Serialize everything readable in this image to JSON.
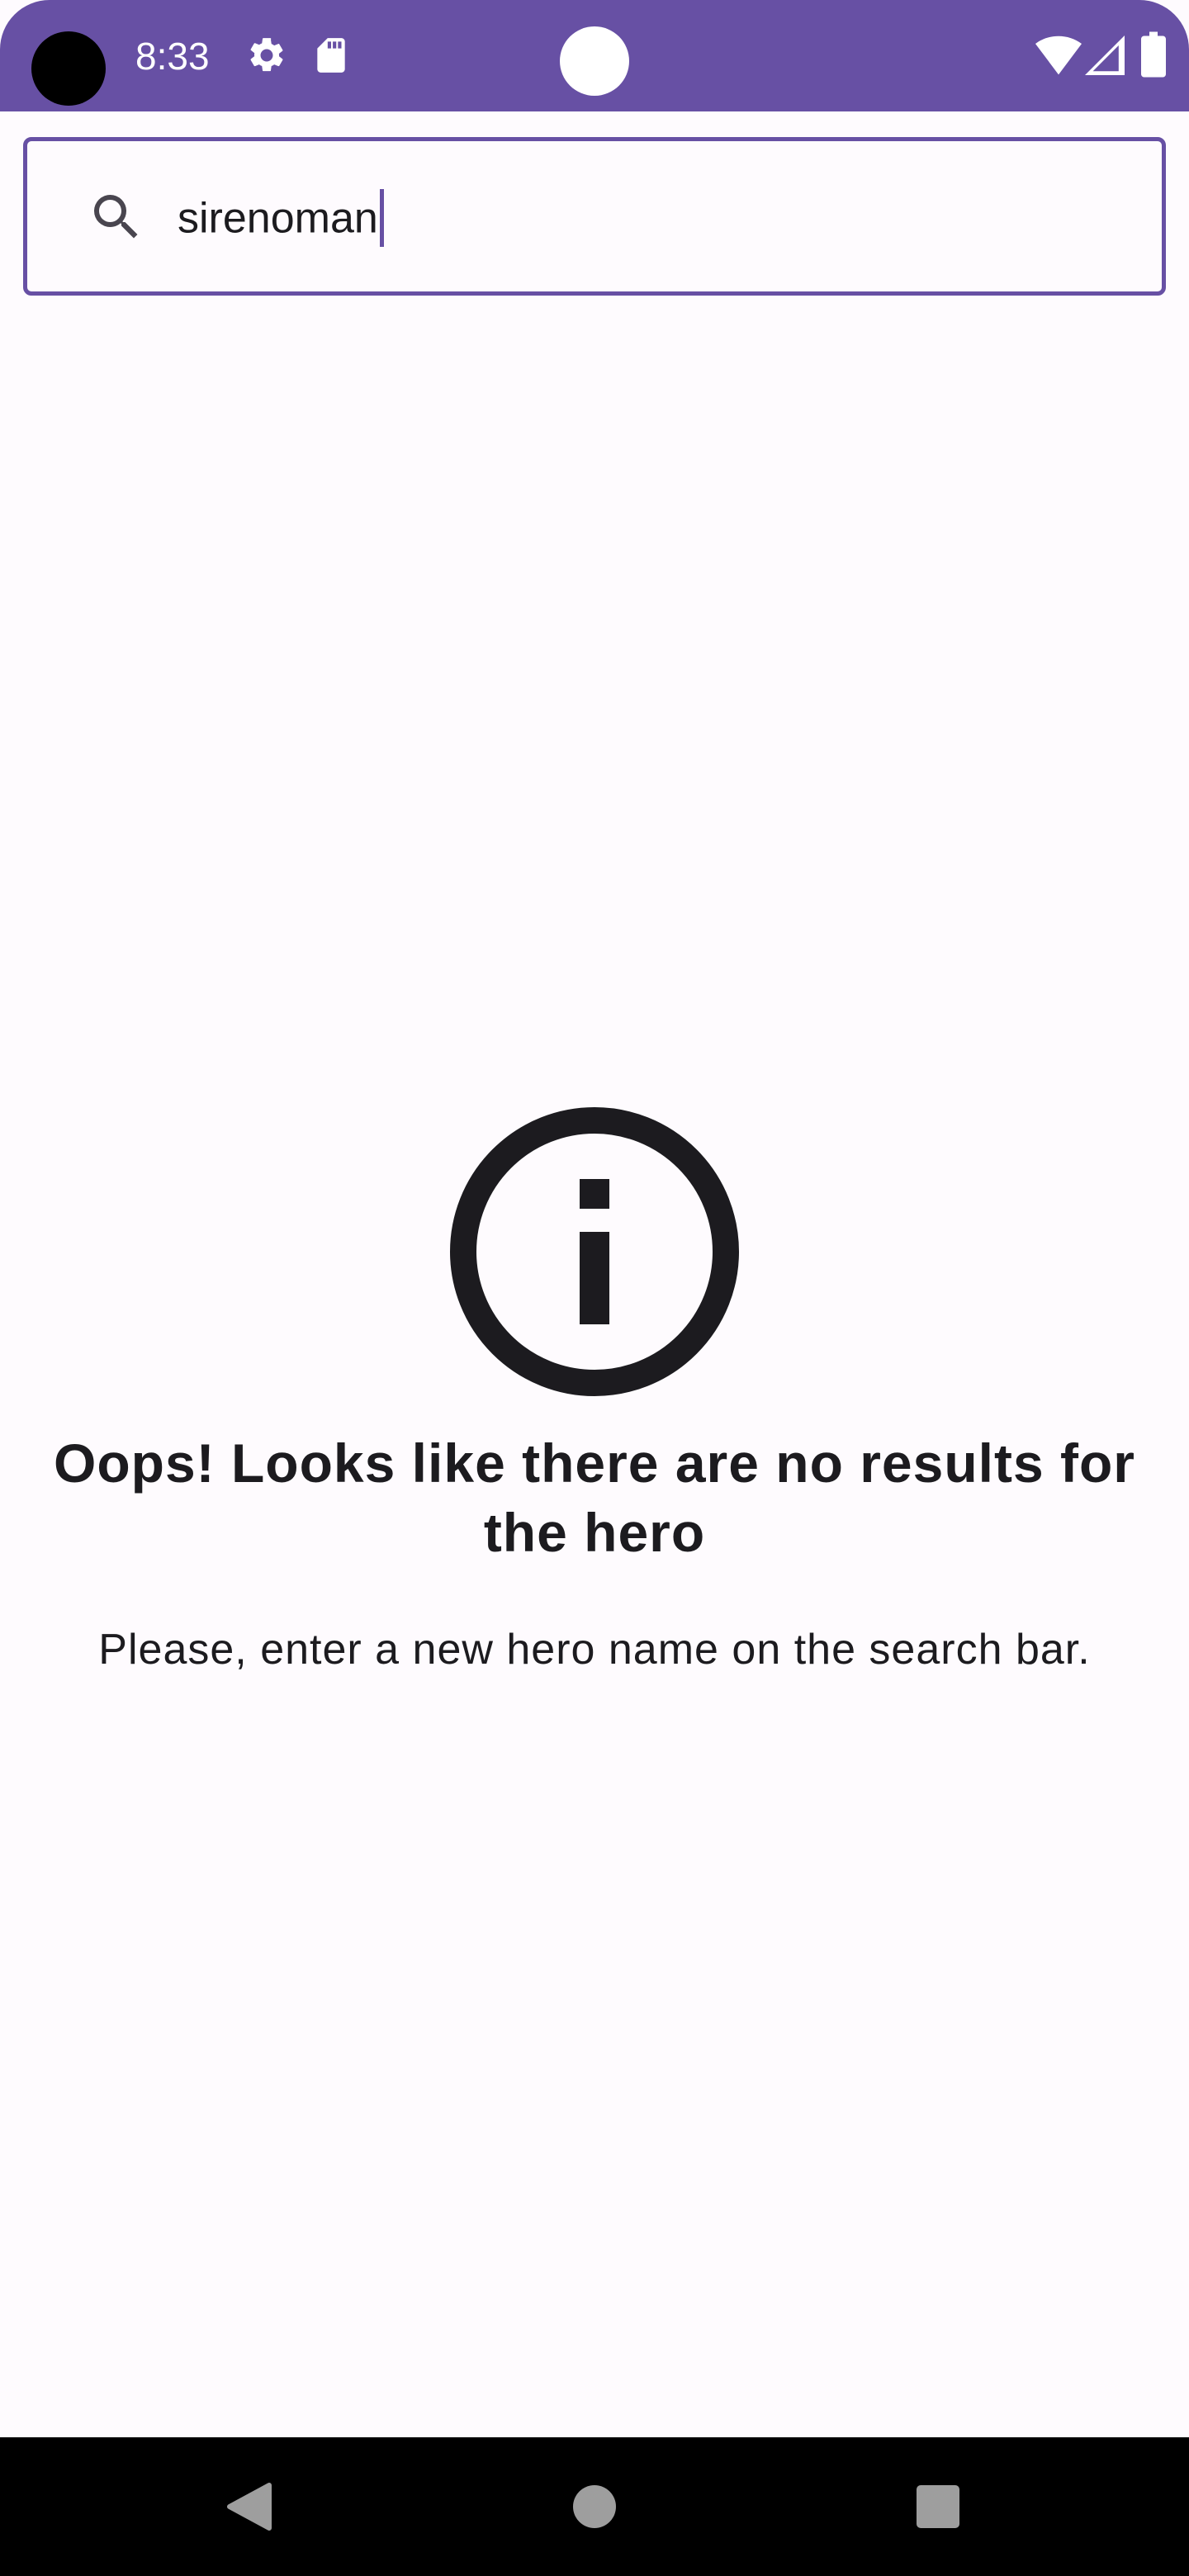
{
  "status_bar": {
    "time": "8:33",
    "icons": [
      "settings-icon",
      "sd-card-icon",
      "wifi-icon",
      "cellular-signal-icon",
      "battery-icon"
    ],
    "background_color": "#6750a4"
  },
  "search": {
    "value": "sirenoman",
    "icon": "search-icon",
    "border_color": "#6750a4"
  },
  "empty_state": {
    "icon": "info-icon",
    "title": "Oops! Looks like there are no results for the hero",
    "message": "Please, enter a new hero name on the search bar."
  },
  "nav_bar": {
    "buttons": [
      "back-button",
      "home-button",
      "recents-button"
    ]
  }
}
